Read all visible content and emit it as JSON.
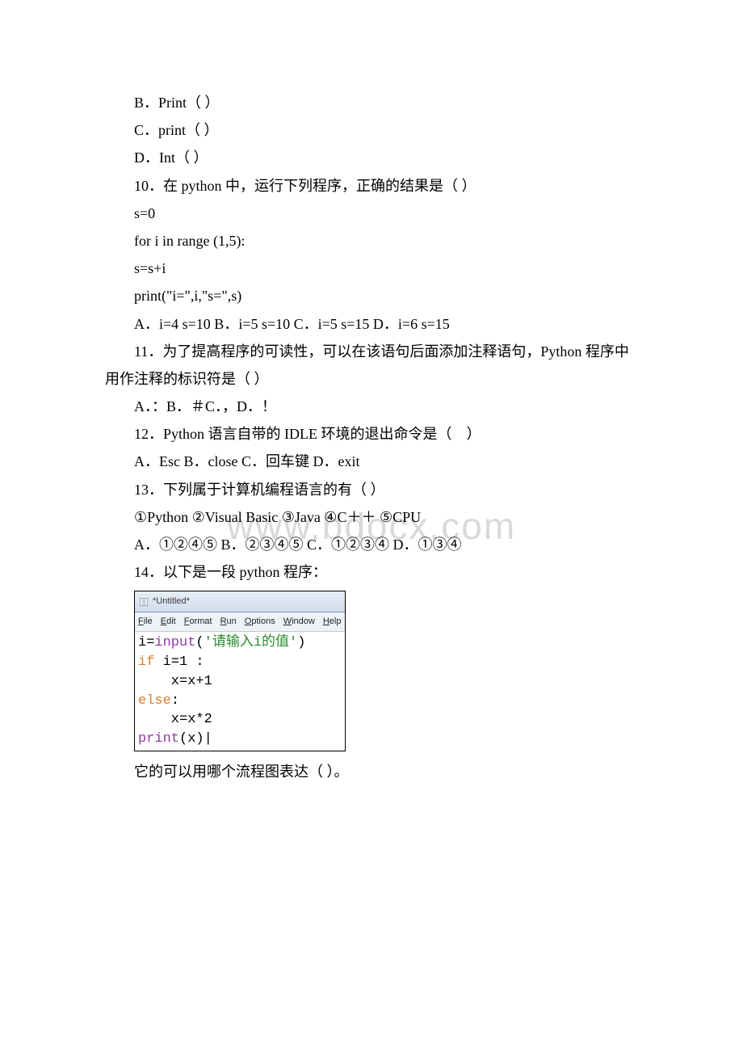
{
  "lines": {
    "b_print_caps": "B．Print（ ）",
    "c_print": "C．print（ ）",
    "d_int": "D．Int（ ）",
    "q10": "10．在 python 中，运行下列程序，正确的结果是（ ）",
    "q10_code1": "s=0",
    "q10_code2": "for i in range (1,5):",
    "q10_code3": " s=s+i",
    "q10_code4": "print(\"i=\",i,\"s=\",s)",
    "q10_opts": "A．i=4 s=10 B．i=5 s=10 C．i=5 s=15 D．i=6 s=15",
    "q11": "11．为了提高程序的可读性，可以在该语句后面添加注释语句，Python 程序中用作注释的标识符是（ ）",
    "q11_opts": "A．：B．＃C．，D．！",
    "q12": "12．Python 语言自带的 IDLE 环境的退出命令是（　）",
    "q12_opts": "A．Esc B．close C．回车键 D．exit",
    "q13": "13．下列属于计算机编程语言的有（ ）",
    "q13_line": "①Python ②Visual Basic ③Java ④C＋＋ ⑤CPU",
    "q13_opts": "A．①②④⑤ B．②③④⑤ C．①②③④ D．①③④",
    "q14": "14．以下是一段 python 程序：",
    "q14_after": "它的可以用哪个流程图表达（ ）。"
  },
  "editor": {
    "title": "*Untitled*",
    "menu": [
      "File",
      "Edit",
      "Format",
      "Run",
      "Options",
      "Window",
      "Help"
    ],
    "code": {
      "l1_a": "i=",
      "l1_b": "input",
      "l1_c": "(",
      "l1_d": "'请输入i的值'",
      "l1_e": ")",
      "l2_a": "if",
      "l2_b": " i=1 :",
      "l3": "    x=x+1",
      "l4_a": "else",
      "l4_b": ":",
      "l5": "    x=x*2",
      "l6_a": "print",
      "l6_b": "(x)|"
    }
  },
  "watermark": "www.bdocx.com"
}
